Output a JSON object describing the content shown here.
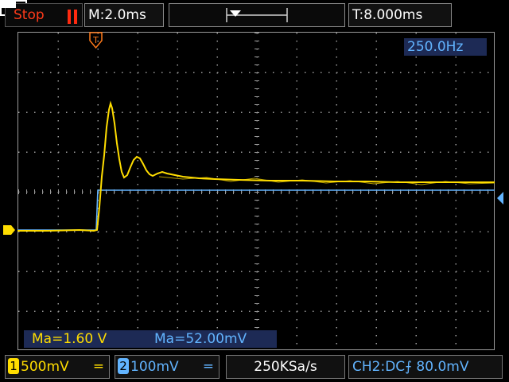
{
  "status": {
    "run_state": "Stop"
  },
  "header": {
    "timebase": "M:2.0ms",
    "trigger_time": "T:8.000ms"
  },
  "frequency": "250.0Hz",
  "measurements": {
    "ch1": "Ma=1.60  V",
    "ch2": "Ma=52.00mV"
  },
  "channels": {
    "ch1": {
      "number": "1",
      "scale": "500mV",
      "coupling_symbol": "═"
    },
    "ch2": {
      "number": "2",
      "scale": "100mV",
      "coupling_symbol": "═"
    }
  },
  "sample_rate": "250KSa/s",
  "coupling_info": "CH2:DC⨍  80.0mV",
  "trigger_marker": "T",
  "colors": {
    "ch1": "#ffdd00",
    "ch2": "#62b4ff",
    "stop": "#ff3a1a",
    "trigger": "#ff7a1a",
    "grid": "#9a9a9a"
  }
}
